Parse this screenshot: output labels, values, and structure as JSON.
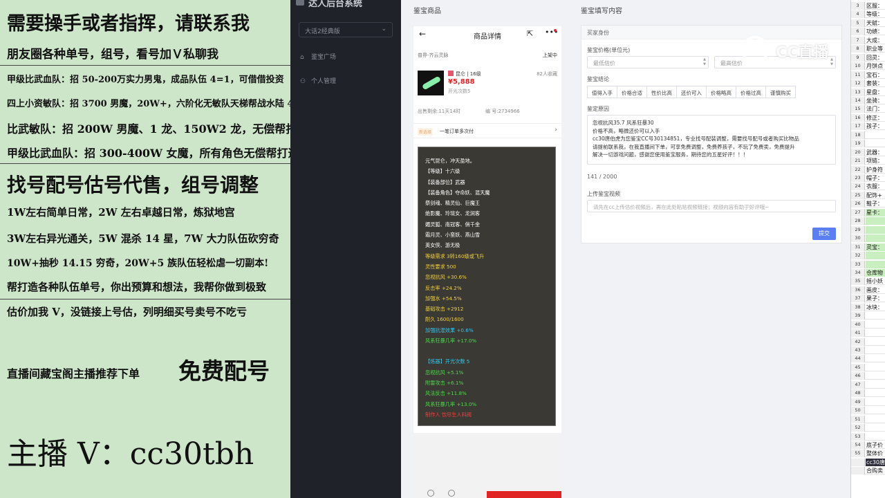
{
  "ad_panel": {
    "lines": [
      "需要操手或者指挥，请联系我",
      "朋友圈各种单号，组号，看号加Ｖ私聊我",
      "甲级比武血队：招 50-200万实力男鬼，成品队伍 4=1，可借借投资",
      "四上小资敏队：招 3700 男魔，20W+，六阶化无敏队天梯帮战水陆 4 等 1",
      "比武敏队：招 200W 男魔、1 龙、150W2 龙，无偿帮打造",
      "甲级比武血队：招 300-400W 女魔，所有角色无偿帮打造",
      "找号配号估号代售，组号调整",
      "1W左右简单日常，2W 左右卓越日常，炼狱地宫",
      "3W左右异光通关，5W 混杀 14 星，7W 大力队伍砍穷奇",
      "10W+抽秒 14.15 穷奇，20W+5 族队伍轻松虐一切副本!",
      "帮打造各种队伍单号，你出预算和想法，我帮你做到极致",
      "估价加我 V，没链接上号估，列明细买号卖号不吃亏",
      "直播间藏宝阁主播推荐下单",
      "免费配号",
      "主播 V：cc30tbh"
    ]
  },
  "sidebar": {
    "title": "达人后台系统",
    "select_value": "大话2经典版",
    "items": [
      {
        "icon": "home-icon",
        "label": "鉴宝广场"
      },
      {
        "icon": "user-icon",
        "label": "个人管理"
      }
    ]
  },
  "sections": {
    "left": "鉴宝商品",
    "right": "鉴宝填写内容"
  },
  "phone": {
    "title": "商品详情",
    "server": "普界-齐云灵脉",
    "status": "上架中",
    "item_name": "昆仑 | 16级",
    "price": "¥5,888",
    "open_count": "开光次数5",
    "favorites": "82人收藏",
    "time_left": "出售剩余:11天14时",
    "item_no": "编 号:2734966",
    "order_badge": "新选择",
    "order_text": "一笔订单多次付",
    "card_lines": [
      {
        "text": "元气昆仑，冲天盈地。",
        "color": "#ffffff"
      },
      {
        "text": "【等级】十六级",
        "color": "#ffffff"
      },
      {
        "text": "【装备部位】武器",
        "color": "#ffffff"
      },
      {
        "text": "【装备角色】夺命妖、混天魔",
        "color": "#ffffff"
      },
      {
        "text": "祭剑魂、精灵仙、巨魔王",
        "color": "#ffffff"
      },
      {
        "text": "绝影魔、玲珑女、龙涧客",
        "color": "#ffffff"
      },
      {
        "text": "媚灵狐、南冠客、俏千金",
        "color": "#ffffff"
      },
      {
        "text": "霜月灵、小蛮妖、燕山雪",
        "color": "#ffffff"
      },
      {
        "text": "英女侠、游无极",
        "color": "#ffffff"
      },
      {
        "text": "等级需求 3转160级或飞升",
        "color": "#f0d040"
      },
      {
        "text": "灵性要求 500",
        "color": "#f0d040"
      },
      {
        "text": "忽视抗风 +30.6%",
        "color": "#f0d040"
      },
      {
        "text": "反击率 +24.2%",
        "color": "#f0d040"
      },
      {
        "text": "加强水 +54.5%",
        "color": "#f0d040"
      },
      {
        "text": "基础攻击 +2912",
        "color": "#f0d040"
      },
      {
        "text": "耐久 1600/1600",
        "color": "#f0d040"
      },
      {
        "text": "加强抗混效果 +0.6%",
        "color": "#39c4e8"
      },
      {
        "text": "风系狂暴几率 +17.0%",
        "color": "#4fd94f"
      },
      {
        "text": "",
        "color": "#ffffff"
      },
      {
        "text": "【炼器】开光次数 5",
        "color": "#39c4e8"
      },
      {
        "text": "忽视抗风 +5.1%",
        "color": "#4fd94f"
      },
      {
        "text": "附雷攻击 +6.1%",
        "color": "#4fd94f"
      },
      {
        "text": "风法反击 +11.8%",
        "color": "#4fd94f"
      },
      {
        "text": "风系狂暴几率 +13.0%",
        "color": "#4fd94f"
      },
      {
        "text": "制作人 饮尽生人科阀",
        "color": "#ff3b3b"
      }
    ]
  },
  "form": {
    "header": "买家身份",
    "price_label": "鉴宝价格(单位元)",
    "min_placeholder": "最低估价",
    "max_placeholder": "最高估价",
    "verdict_label": "鉴宝结论",
    "verdicts": [
      "值得入手",
      "价格合适",
      "性价比高",
      "还价可入",
      "价格略高",
      "价格过高",
      "谨慎购买"
    ],
    "reason_label": "鉴定原因",
    "reason_lines": [
      "忽视抗风35.7 风系狂暴30",
      "价格不高，略微还价可以入手",
      "cc30唐伯虎为您鉴宝CC号30134851，专业找号配装调整，需要找号配号或者购买比物品",
      "请提前联系我，在我直播间下单，可享免费调整，免费养孩子，不玩了免费卖，免费提升",
      "解决一切游戏问题，感谢您使用鉴宝服务，期待您的五星好评！！！"
    ],
    "char_count": "141 / 2000",
    "video_label": "上传鉴宝视频",
    "video_placeholder": "请先在cc上传估价视频后，再在此处粘贴视频链接；视频内容有助于好评哦~",
    "submit": "提交"
  },
  "watermark": "CC直播",
  "sheet": {
    "rows": [
      {
        "n": "3",
        "t": "区服：",
        "s": ""
      },
      {
        "n": "4",
        "t": "等级：",
        "s": ""
      },
      {
        "n": "5",
        "t": "天赋：",
        "s": ""
      },
      {
        "n": "6",
        "t": "功绩：",
        "s": ""
      },
      {
        "n": "7",
        "t": "大成：",
        "s": ""
      },
      {
        "n": "8",
        "t": "职业等",
        "s": ""
      },
      {
        "n": "9",
        "t": "回灵：",
        "s": ""
      },
      {
        "n": "10",
        "t": "月饼点",
        "s": ""
      },
      {
        "n": "11",
        "t": "宝石：",
        "s": ""
      },
      {
        "n": "12",
        "t": "套装：",
        "s": ""
      },
      {
        "n": "13",
        "t": "星盘：",
        "s": ""
      },
      {
        "n": "14",
        "t": "坐骑：",
        "s": ""
      },
      {
        "n": "15",
        "t": "法门：",
        "s": ""
      },
      {
        "n": "16",
        "t": "修正：",
        "s": ""
      },
      {
        "n": "17",
        "t": "孩子：",
        "s": ""
      },
      {
        "n": "18",
        "t": "",
        "s": ""
      },
      {
        "n": "19",
        "t": "",
        "s": ""
      },
      {
        "n": "20",
        "t": "武器：",
        "s": ""
      },
      {
        "n": "21",
        "t": "项链：",
        "s": ""
      },
      {
        "n": "22",
        "t": "护身符",
        "s": ""
      },
      {
        "n": "23",
        "t": "帽子：",
        "s": ""
      },
      {
        "n": "24",
        "t": "衣服：",
        "s": ""
      },
      {
        "n": "25",
        "t": "配饰+",
        "s": ""
      },
      {
        "n": "26",
        "t": "鞋子：",
        "s": ""
      },
      {
        "n": "27",
        "t": "星卡：",
        "s": "g"
      },
      {
        "n": "28",
        "t": "",
        "s": "g"
      },
      {
        "n": "29",
        "t": "",
        "s": "g"
      },
      {
        "n": "30",
        "t": "",
        "s": "g"
      },
      {
        "n": "31",
        "t": "灵宝：",
        "s": "g"
      },
      {
        "n": "32",
        "t": "",
        "s": "g"
      },
      {
        "n": "33",
        "t": "",
        "s": "g"
      },
      {
        "n": "34",
        "t": "仓库物",
        "s": "g"
      },
      {
        "n": "35",
        "t": "摇小妖",
        "s": ""
      },
      {
        "n": "36",
        "t": "画皮：",
        "s": ""
      },
      {
        "n": "37",
        "t": "果子：",
        "s": ""
      },
      {
        "n": "38",
        "t": "冰块：",
        "s": ""
      },
      {
        "n": "39",
        "t": "",
        "s": ""
      },
      {
        "n": "40",
        "t": "",
        "s": ""
      },
      {
        "n": "41",
        "t": "",
        "s": ""
      },
      {
        "n": "42",
        "t": "",
        "s": ""
      },
      {
        "n": "43",
        "t": "",
        "s": ""
      },
      {
        "n": "44",
        "t": "",
        "s": ""
      },
      {
        "n": "45",
        "t": "",
        "s": ""
      },
      {
        "n": "46",
        "t": "",
        "s": ""
      },
      {
        "n": "47",
        "t": "",
        "s": ""
      },
      {
        "n": "48",
        "t": "",
        "s": ""
      },
      {
        "n": "49",
        "t": "",
        "s": ""
      },
      {
        "n": "50",
        "t": "",
        "s": ""
      },
      {
        "n": "51",
        "t": "",
        "s": ""
      },
      {
        "n": "52",
        "t": "",
        "s": ""
      },
      {
        "n": "53",
        "t": "",
        "s": ""
      },
      {
        "n": "54",
        "t": "底子价",
        "s": ""
      },
      {
        "n": "55",
        "t": "整体价",
        "s": ""
      },
      {
        "n": "",
        "t": "cc30唐",
        "s": "d"
      },
      {
        "n": "",
        "t": "合购卖",
        "s": ""
      }
    ]
  }
}
